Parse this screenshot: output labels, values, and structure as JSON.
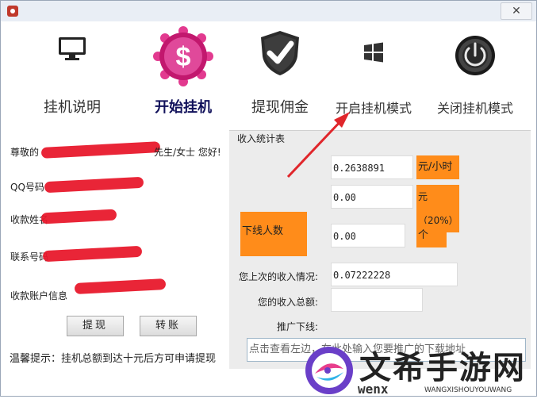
{
  "window": {
    "close_label": "✕"
  },
  "nav": {
    "items": [
      {
        "label": "挂机说明",
        "icon": "monitor-icon",
        "active": false
      },
      {
        "label": "开始挂机",
        "icon": "dollar-badge-icon",
        "active": true
      },
      {
        "label": "提现佣金",
        "icon": "shield-check-icon",
        "active": false
      },
      {
        "label": "开启挂机模式",
        "icon": "windows-logo-icon",
        "active": false
      },
      {
        "label": "关闭挂机模式",
        "icon": "power-icon",
        "active": false
      }
    ]
  },
  "left": {
    "greeting_prefix": "尊敬的",
    "greeting_suffix": "先生/女士   您好!",
    "qq_label": "QQ号码",
    "name_label": "收款姓名",
    "phone_label": "联系号码",
    "account_label": "收款账户信息",
    "withdraw_button": "提现",
    "transfer_button": "转账",
    "hint": "温馨提示：挂机总额到达十元后方可申请提现"
  },
  "income": {
    "group_title": "收入统计表",
    "rate_value": "0.2638891",
    "rate_unit": "元/小时",
    "commission_value": "0.00",
    "commission_unit": "元（20%）",
    "downline_label": "下线人数",
    "downline_value": "0.00",
    "downline_unit": "个",
    "last_income_label": "您上次的收入情况:",
    "last_income_value": "0.07222228",
    "total_income_label": "您的收入总额:",
    "total_income_value": "",
    "promote_label": "推广下线:",
    "promote_placeholder": "点击查看左边，在此处输入您要推广的下载地址"
  },
  "watermark": {
    "brand": "文希手游网",
    "domain": "WANGXISHOUYOUWANG",
    "letters": "wenx"
  },
  "colors": {
    "accent": "#ff8c1a",
    "redaction": "#e8192c",
    "arrow": "#e0262b"
  }
}
